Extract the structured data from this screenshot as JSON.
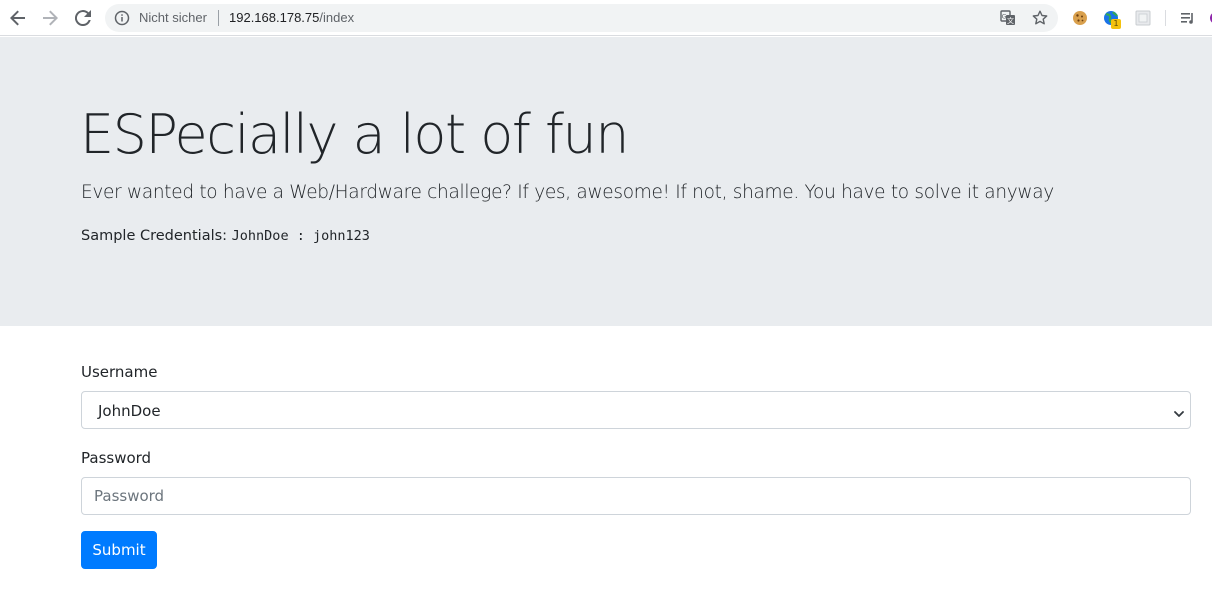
{
  "browser": {
    "security_label": "Nicht sicher",
    "url_host": "192.168.178.75",
    "url_path": "/index",
    "extension_badge": "1",
    "icons": [
      "back-arrow-icon",
      "forward-arrow-icon",
      "reload-icon",
      "info-icon",
      "translate-icon",
      "bookmark-star-icon",
      "cookie-extension-icon",
      "globe-extension-icon",
      "extension-icon",
      "media-queue-icon",
      "profile-icon"
    ]
  },
  "jumbotron": {
    "title": "ESPecially a lot of fun",
    "lead": "Ever wanted to have a Web/Hardware challege? If yes, awesome! If not, shame. You have to solve it anyway",
    "credentials_label": "Sample Credentials:",
    "credentials_user": "JohnDoe",
    "credentials_sep": " : ",
    "credentials_pass": "john123"
  },
  "form": {
    "username_label": "Username",
    "username_selected": "JohnDoe",
    "password_label": "Password",
    "password_placeholder": "Password",
    "submit_label": "Submit"
  },
  "colors": {
    "jumbotron_bg": "#e9ecef",
    "primary": "#007bff",
    "input_border": "#ced4da"
  }
}
